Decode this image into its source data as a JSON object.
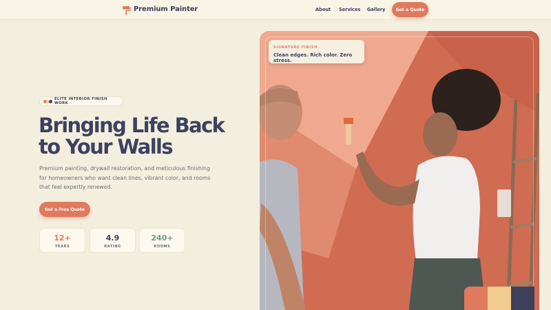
{
  "header": {
    "brand": "Premium Painter",
    "nav": [
      "About",
      "Services",
      "Gallery"
    ],
    "cta": "Get a Quote"
  },
  "hero": {
    "eyebrow": "ELITE INTERIOR FINISH WORK",
    "title": "Bringing Life Back to Your Walls",
    "subtitle": "Premium painting, drywall restoration, and meticulous finishing for homeowners who want clean lines, vibrant color, and rooms that feel expertly renewed.",
    "cta": "Get a Free Quote",
    "stats": [
      {
        "value": "12+",
        "label": "YEARS",
        "color": "#e07a5f"
      },
      {
        "value": "4.9",
        "label": "RATING",
        "color": "#3b3f5c"
      },
      {
        "value": "240+",
        "label": "ROOMS",
        "color": "#6aa08a"
      }
    ]
  },
  "image_badge": {
    "kicker": "SIGNATURE FINISH",
    "title": "Clean edges. Rich color. Zero stress."
  },
  "colors": {
    "accent": "#e07a5f",
    "navy": "#3d4160",
    "sand": "#f2cc8f",
    "green": "#6aa08a",
    "background": "#f3efdf"
  },
  "swatches": [
    "#e07a5f",
    "#f2cc8f",
    "#3d405b"
  ],
  "icons": {
    "logo": "paint-roller-icon"
  }
}
